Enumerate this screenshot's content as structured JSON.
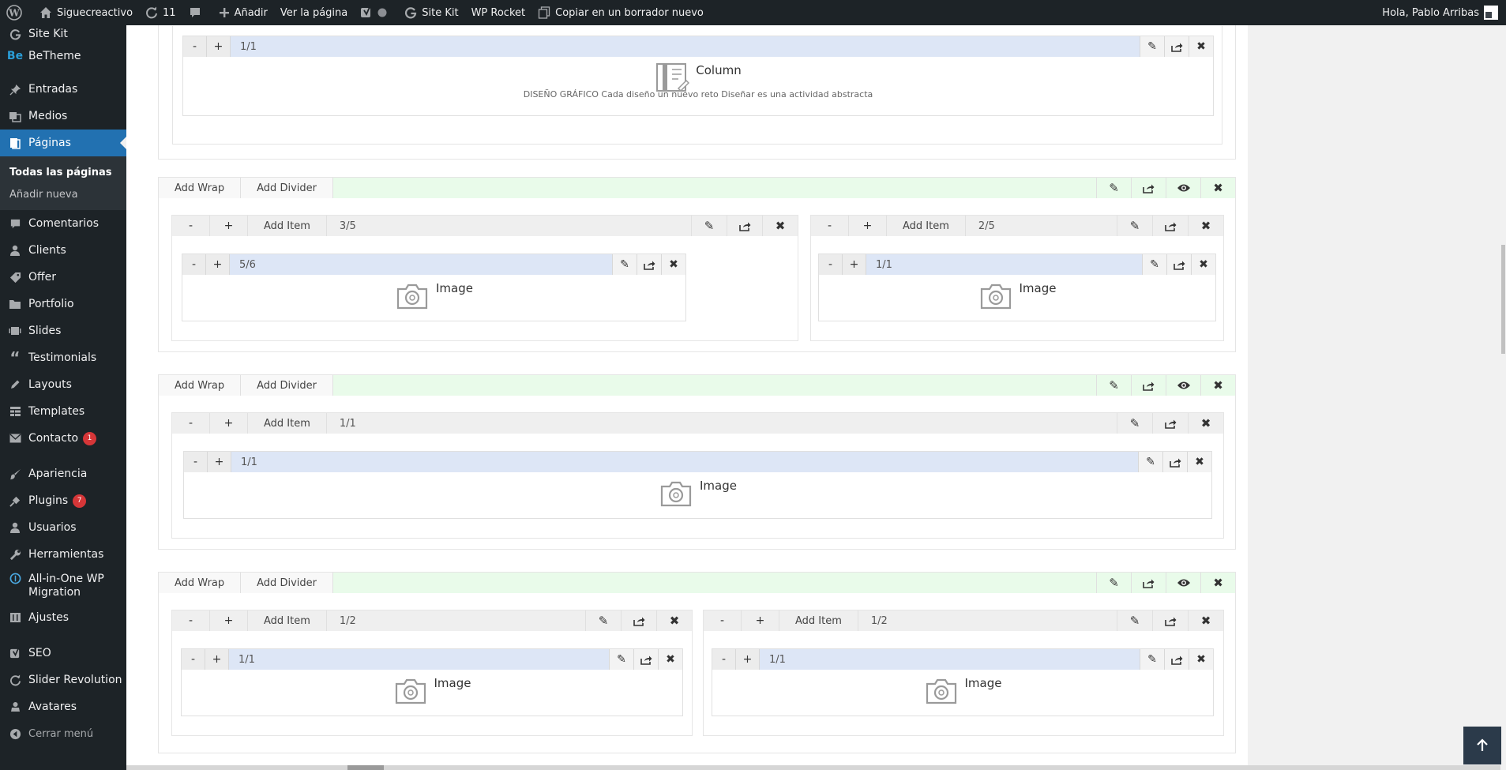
{
  "adminbar": {
    "site_name": "Siguecreactivo",
    "updates_count": "11",
    "add_label": "Añadir",
    "view_page_label": "Ver la página",
    "sitekit_label": "Site Kit",
    "wprocket_label": "WP Rocket",
    "copy_draft_label": "Copiar en un borrador nuevo",
    "greeting": "Hola, Pablo Arribas"
  },
  "sidebar": {
    "top_items": [
      {
        "label": "Site Kit"
      },
      {
        "label": "BeTheme"
      },
      {
        "label": "Entradas"
      },
      {
        "label": "Medios"
      },
      {
        "label": "Páginas"
      }
    ],
    "submenu": [
      {
        "label": "Todas las páginas"
      },
      {
        "label": "Añadir nueva"
      }
    ],
    "items": [
      {
        "label": "Comentarios"
      },
      {
        "label": "Clients"
      },
      {
        "label": "Offer"
      },
      {
        "label": "Portfolio"
      },
      {
        "label": "Slides"
      },
      {
        "label": "Testimonials"
      },
      {
        "label": "Layouts"
      },
      {
        "label": "Templates"
      },
      {
        "label": "Contacto",
        "badge": "1"
      }
    ],
    "items2": [
      {
        "label": "Apariencia"
      },
      {
        "label": "Plugins",
        "badge": "7"
      },
      {
        "label": "Usuarios"
      },
      {
        "label": "Herramientas"
      },
      {
        "label": "All-in-One WP Migration"
      },
      {
        "label": "Ajustes"
      }
    ],
    "items3": [
      {
        "label": "SEO"
      },
      {
        "label": "Slider Revolution"
      },
      {
        "label": "Avatares"
      },
      {
        "label": "Cerrar menú"
      }
    ]
  },
  "builder": {
    "add_wrap_label": "Add Wrap",
    "add_divider_label": "Add Divider",
    "add_item_label": "Add Item",
    "minus": "-",
    "plus": "+",
    "top": {
      "item_size": "1/1",
      "item_title": "Column",
      "item_desc": "DISEÑO GRÁFICO Cada diseño un nuevo reto Diseñar es una actividad abstracta"
    },
    "s1": {
      "wrap1_size": "3/5",
      "item1_size": "5/6",
      "item1_title": "Image",
      "wrap2_size": "2/5",
      "item2_size": "1/1",
      "item2_title": "Image"
    },
    "s2": {
      "wrap1_size": "1/1",
      "item1_size": "1/1",
      "item1_title": "Image"
    },
    "s3": {
      "wrap1_size": "1/2",
      "item1_size": "1/1",
      "item1_title": "Image",
      "wrap2_size": "1/2",
      "item2_size": "1/1",
      "item2_title": "Image"
    }
  },
  "icons": {
    "edit": "pencil-icon",
    "clone": "share-icon",
    "visibility": "eye-icon",
    "delete": "close-icon",
    "scroll_top": "arrow-up-icon"
  }
}
